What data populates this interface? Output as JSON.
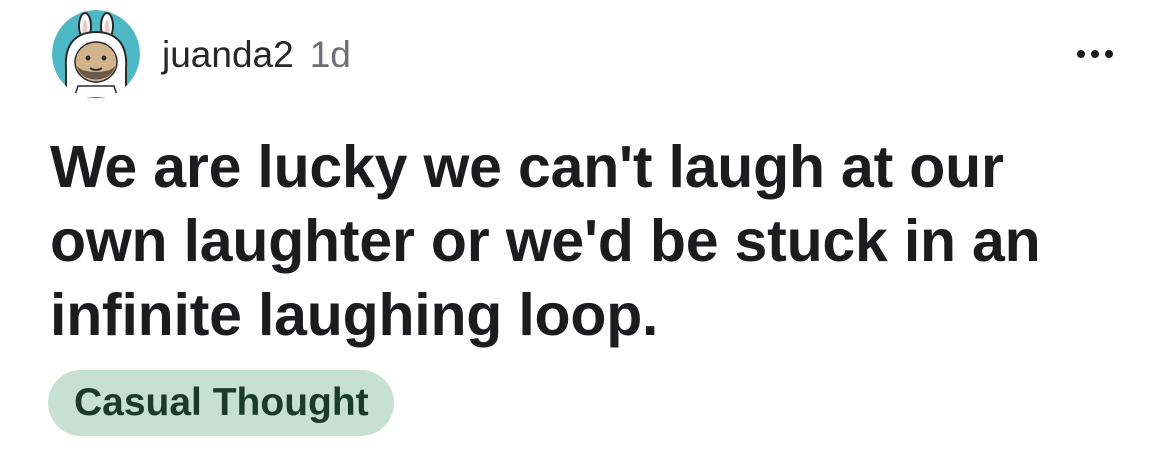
{
  "post": {
    "author": {
      "username": "juanda2",
      "avatar_icon": "bunny-hat-avatar-icon"
    },
    "timestamp": "1d",
    "more_icon": "more-options-icon",
    "text": "We are lucky we can't laugh at our own laughter or we'd be stuck in an infinite laughing loop.",
    "tag": "Casual Thought"
  },
  "colors": {
    "avatar_background": "#4fb8c6",
    "tag_background": "#c6e1d1",
    "tag_text": "#1b3a2a",
    "body_text": "#1c1c1e",
    "meta_text": "#6e6e73"
  }
}
